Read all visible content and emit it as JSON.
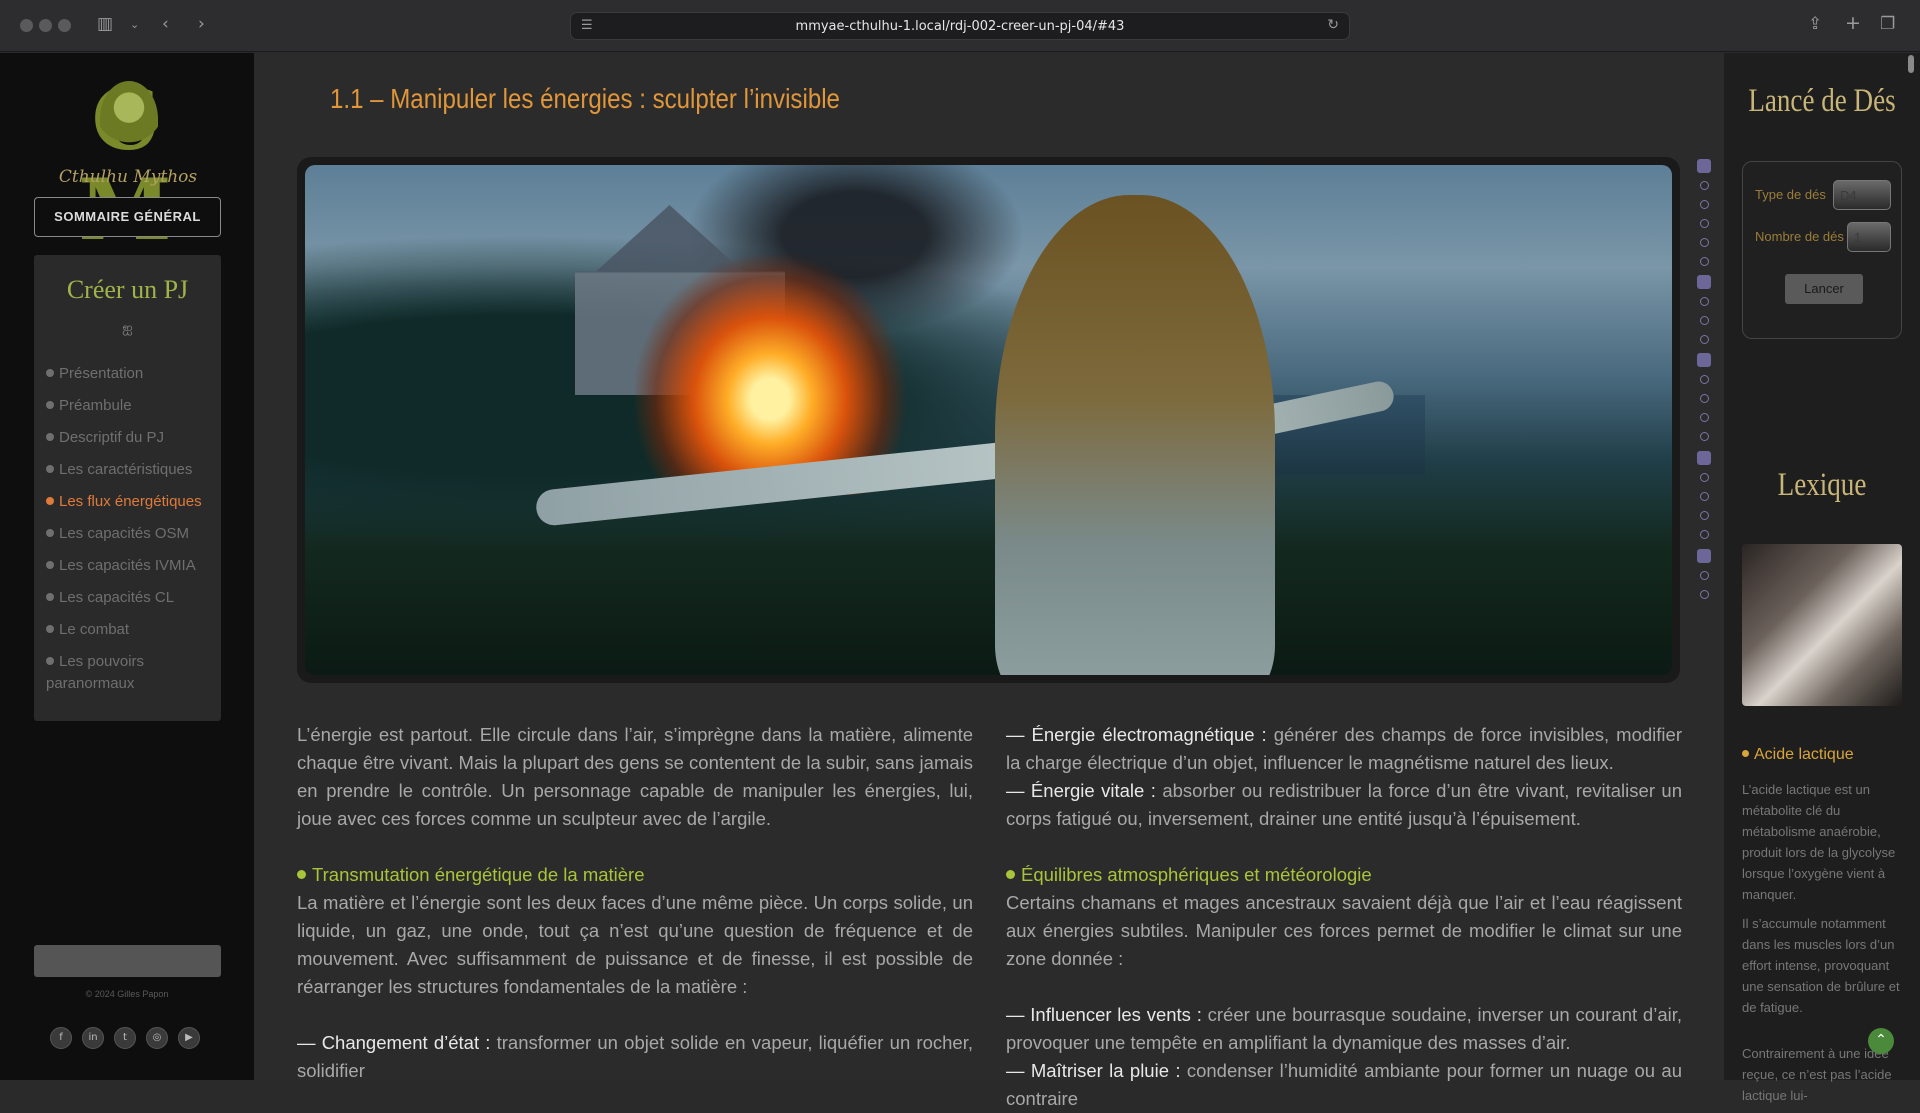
{
  "browser": {
    "url": "mmyae-cthulhu-1.local/rdj-002-creer-un-pj-04/#43"
  },
  "left_sidebar": {
    "logo_letters": "C  M",
    "logo_subtitle": "Cthulhu Mythos",
    "sommaire_label": "SOMMAIRE GÉNÉRAL",
    "toc_title": "Créer un PJ",
    "toc_ornament": "ஐ",
    "toc_items": [
      {
        "label": "Présentation",
        "active": false
      },
      {
        "label": "Préambule",
        "active": false
      },
      {
        "label": "Descriptif du PJ",
        "active": false
      },
      {
        "label": "Les caractéristiques",
        "active": false
      },
      {
        "label": "Les flux énergétiques",
        "active": true
      },
      {
        "label": "Les capacités OSM",
        "active": false
      },
      {
        "label": "Les capacités IVMIA",
        "active": false
      },
      {
        "label": "Les capacités CL",
        "active": false
      },
      {
        "label": "Le combat",
        "active": false
      },
      {
        "label": "Les pouvoirs paranormaux",
        "active": false
      }
    ],
    "copyright": "© 2024 Gilles Papon",
    "socials": [
      "facebook-icon",
      "linkedin-icon",
      "twitter-icon",
      "instagram-icon",
      "youtube-icon"
    ]
  },
  "main": {
    "title": "1.1 – Manipuler les énergies : sculpter l’invisible",
    "left_column": {
      "intro": "L’énergie est partout. Elle circule dans l’air, s’imprègne dans la matière, alimente chaque être vivant. Mais la plupart des gens se contentent de la subir, sans jamais en prendre le contrôle. Un personnage capable de manipuler les énergies, lui, joue avec ces forces comme un sculpteur avec de l’argile.",
      "section_heading": "Transmutation énergétique de la matière",
      "section_text": "La matière et l’énergie sont les deux faces d’une même pièce. Un corps solide, un liquide, un gaz, une onde, tout ça n’est qu’une question de fréquence et de mouvement. Avec suffisamment de puissance et de finesse, il est possible de réarranger les structures fondamentales de la matière :",
      "item_term": "— Changement d’état :",
      "item_text": " transformer un objet solide en vapeur, liquéfier un rocher, solidifier"
    },
    "right_column": {
      "item1_term": "— Énergie électromagnétique :",
      "item1_text": " générer des champs de force invisibles, modifier la charge électrique d’un objet, influencer le magnétisme naturel des lieux.",
      "item2_term": "— Énergie vitale :",
      "item2_text": " absorber ou redistribuer la force d’un être vivant, revitaliser un corps fatigué ou, inversement, drainer une entité jusqu’à l’épuisement.",
      "section_heading": "Équilibres atmosphériques et météorologie",
      "section_text": "Certains chamans et mages ancestraux savaient déjà que l’air et l’eau réagissent aux énergies subtiles. Manipuler ces forces permet de modifier le climat sur une zone donnée :",
      "item3_term": "— Influencer les vents :",
      "item3_text": " créer une bourrasque soudaine, inverser un courant d’air, provoquer une tempête en amplifiant la dynamique des masses d’air.",
      "item4_term": "— Maîtriser la pluie :",
      "item4_text": " condenser l’humidité ambiante pour former un nuage ou au contraire"
    }
  },
  "right_sidebar": {
    "dice_title": "Lancé de Dés",
    "dice_type_label": "Type de dés",
    "dice_type_value": "D4",
    "dice_count_label": "Nombre de dés",
    "dice_count_value": "1",
    "roll_button": "Lancer",
    "lexique_title": "Lexique",
    "lexique_word": "Acide lactique",
    "lexique_p1": "L’acide lactique est un métabolite clé du métabolisme anaérobie, produit lors de la glycolyse lorsque l’oxygène vient à manquer.",
    "lexique_p2": "Il s’accumule notamment dans les muscles lors d’un effort intense, provoquant une sensation de brûlure et de fatigue.",
    "lexique_p3": "Contrairement à une idée reçue, ce n’est pas l’acide lactique lui-"
  }
}
